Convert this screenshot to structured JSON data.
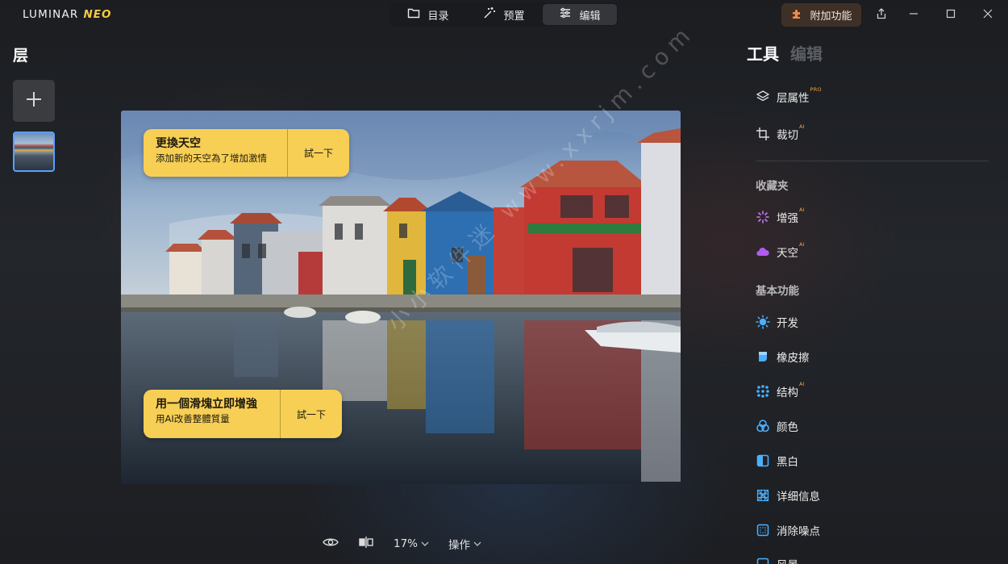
{
  "titlebar": {
    "logo_main": "LUMINAR",
    "logo_neo": "NEO",
    "tabs": [
      {
        "label": "目录",
        "icon": "folder-icon"
      },
      {
        "label": "预置",
        "icon": "magic-wand-icon"
      },
      {
        "label": "编辑",
        "icon": "sliders-icon",
        "active": true
      }
    ],
    "addon_label": "附加功能",
    "addon_color": "#3f3027"
  },
  "layers": {
    "title": "层"
  },
  "promos": [
    {
      "heading": "更換天空",
      "subtext": "添加新的天空為了增加激情",
      "action": "試一下"
    },
    {
      "heading": "用一個滑塊立即增強",
      "subtext": "用AI改善整體質量",
      "action": "試一下"
    }
  ],
  "watermark": "小小软件迷 www.xxrjm.com",
  "bottom": {
    "zoom": "17%",
    "actions_label": "操作"
  },
  "tools_panel": {
    "tab_tools": "工具",
    "tab_edit": "编辑",
    "items_top": [
      {
        "label": "层属性",
        "badge": "PRO",
        "icon": "layers-icon"
      },
      {
        "label": "裁切",
        "badge": "AI",
        "icon": "crop-icon"
      }
    ],
    "favorites_title": "收藏夹",
    "favorites": [
      {
        "label": "增强",
        "badge": "AI",
        "icon": "sparkle-icon",
        "color": "#c77dff"
      },
      {
        "label": "天空",
        "badge": "AI",
        "icon": "cloud-icon",
        "color": "#b05cf0"
      }
    ],
    "basic_title": "基本功能",
    "basic": [
      {
        "label": "开发",
        "icon": "sun-icon",
        "color": "#4ab0ff"
      },
      {
        "label": "橡皮擦",
        "icon": "eraser-icon",
        "color": "#4ab0ff"
      },
      {
        "label": "结构",
        "badge": "AI",
        "icon": "structure-icon",
        "color": "#4ab0ff"
      },
      {
        "label": "颜色",
        "icon": "color-circles-icon",
        "color": "#4ab0ff"
      },
      {
        "label": "黑白",
        "icon": "black-white-icon",
        "color": "#4ab0ff"
      },
      {
        "label": "详细信息",
        "icon": "detail-grid-icon",
        "color": "#4ab0ff"
      },
      {
        "label": "消除噪点",
        "icon": "denoise-icon",
        "color": "#4ab0ff"
      },
      {
        "label": "风景",
        "icon": "landscape-icon",
        "color": "#4ab0ff"
      }
    ]
  }
}
